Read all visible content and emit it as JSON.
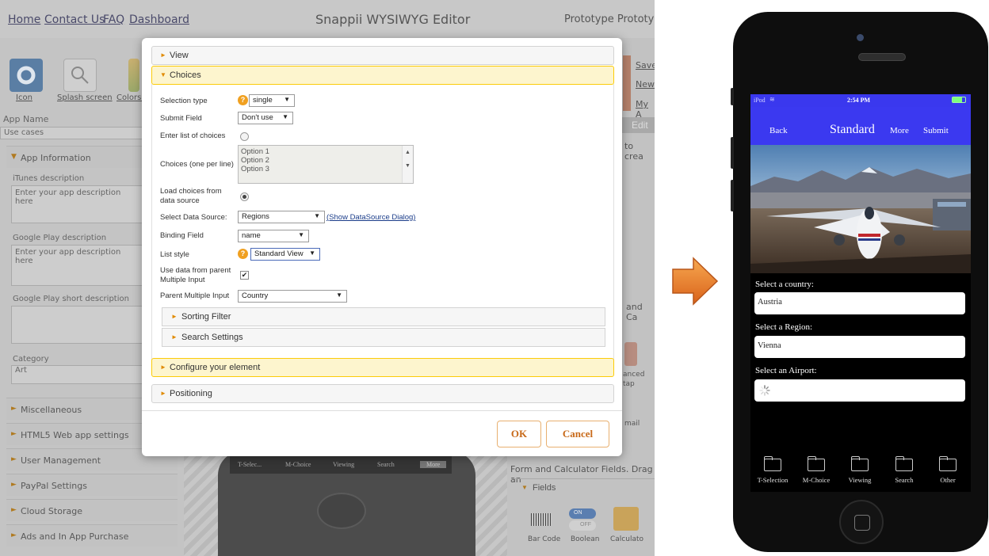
{
  "editor": {
    "nav_links": [
      "Home",
      "Contact Us",
      "FAQ",
      "Dashboard"
    ],
    "title": "Snappii WYSIWYG Editor",
    "project_name": "Prototype Prototyp",
    "tools": [
      "Icon",
      "Splash screen",
      "Colors a"
    ],
    "app_name_label": "App Name",
    "app_name_value": "Use cases",
    "sections": [
      "App Information",
      "Miscellaneous",
      "HTML5 Web app settings",
      "User Management",
      "PayPal Settings",
      "Cloud Storage",
      "Ads and In App Purchase"
    ],
    "itunes_label": "iTunes description",
    "itunes_placeholder": "Enter your app description here",
    "gplay_label": "Google Play description",
    "gplay_placeholder": "Enter your app description here",
    "gplay_short_label": "Google Play short description",
    "category_label": "Category",
    "category_value": "Art",
    "right_links": [
      "Save",
      "New",
      "My A"
    ],
    "right_edit": "Edit",
    "right_to_create": "to crea",
    "right_and": "and Ca",
    "right_advanced": "anced",
    "right_map": "tap",
    "right_mail": "mail",
    "form_calc_text": "Form and Calculator Fields. Drag an",
    "fields_label": "Fields",
    "field_tools": [
      "Bar Code",
      "Boolean",
      "Calculato"
    ],
    "toggle_on": "ON",
    "toggle_off": "OFF",
    "bg_phone_tabs": [
      "T-Selec...",
      "M-Choice",
      "Viewing",
      "Search",
      "More"
    ]
  },
  "modal": {
    "sections": {
      "view": "View",
      "choices": "Choices",
      "configure": "Configure your element",
      "positioning": "Positioning"
    },
    "selection_type_label": "Selection type",
    "selection_type_value": "single",
    "submit_field_label": "Submit Field",
    "submit_field_value": "Don't use",
    "enter_list_label": "Enter list of choices",
    "choices_label": "Choices (one per line)",
    "choices_lines": [
      "Option 1",
      "Option 2",
      "Option 3"
    ],
    "load_choices_label_1": "Load choices from",
    "load_choices_label_2": "data source",
    "data_source_label": "Select Data Source:",
    "data_source_value": "Regions",
    "datasource_link": "(Show DataSource Dialog)",
    "binding_field_label": "Binding Field",
    "binding_field_value": "name",
    "list_style_label": "List style",
    "list_style_value": "Standard View",
    "use_parent_label_1": "Use data from parent",
    "use_parent_label_2": "Multiple Input",
    "parent_input_label": "Parent Multiple Input",
    "parent_input_value": "Country",
    "sorting_filter": "Sorting Filter",
    "search_settings": "Search Settings",
    "ok_label": "OK",
    "cancel_label": "Cancel",
    "help_badge": "?"
  },
  "phone": {
    "status_carrier": "iPod",
    "status_time": "2:54 PM",
    "nav_back": "Back",
    "nav_title": "Standard",
    "nav_more": "More",
    "nav_submit": "Submit",
    "country_label": "Select a country:",
    "country_value": "Austria",
    "region_label": "Select a Region:",
    "region_value": "Vienna",
    "airport_label": "Select an Airport:",
    "tabs": [
      "T-Selection",
      "M-Choice",
      "Viewing",
      "Search",
      "Other"
    ]
  },
  "colors": {
    "nav_blue": "#3b39f0",
    "accent_orange": "#e08a00",
    "arrow_orange": "#e8791f"
  }
}
